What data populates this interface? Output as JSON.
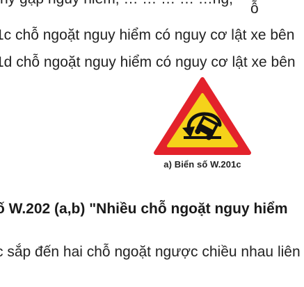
{
  "text": {
    "top_partial": "ny gặp nguy hiểm, … … … … …ng,",
    "line1": "1c chỗ ngoặt nguy hiểm có nguy cơ lật xe bên",
    "line2": "1d chỗ ngoặt nguy hiểm có nguy cơ lật xe bên",
    "heading": "ố W.202 (a,b) \"Nhiều chỗ ngoặt nguy hiểm",
    "line3": "c sắp đến hai chỗ ngoặt ngược chiều nhau liên",
    "bottom_fragment": "ỗ"
  },
  "figure": {
    "caption": "a) Biển số W.201c",
    "sign_border_color": "#e3222b",
    "sign_fill_color": "#f5d21a",
    "symbol_color": "#111111"
  }
}
